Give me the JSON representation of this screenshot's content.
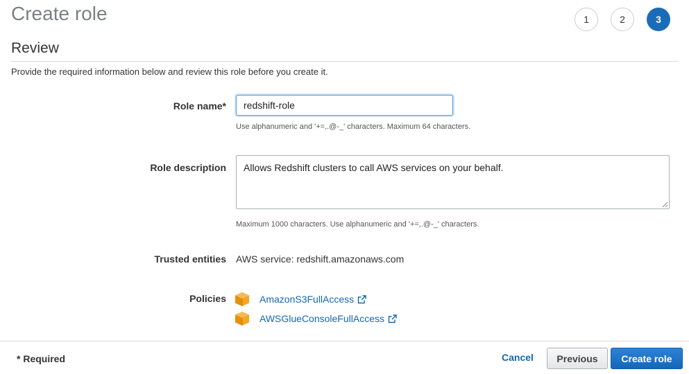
{
  "header": {
    "title": "Create role",
    "steps": [
      "1",
      "2",
      "3"
    ],
    "active_step": "3"
  },
  "review": {
    "section_title": "Review",
    "intro": "Provide the required information below and review this role before you create it."
  },
  "form": {
    "role_name": {
      "label": "Role name*",
      "value": "redshift-role",
      "hint": "Use alphanumeric and '+=,.@-_' characters. Maximum 64 characters."
    },
    "role_description": {
      "label": "Role description",
      "value": "Allows Redshift clusters to call AWS services on your behalf.",
      "hint": "Maximum 1000 characters. Use alphanumeric and '+=,.@-_' characters."
    },
    "trusted_entities": {
      "label": "Trusted entities",
      "value": "AWS service: redshift.amazonaws.com"
    },
    "policies": {
      "label": "Policies",
      "items": [
        {
          "name": "AmazonS3FullAccess",
          "icon": "policy-box-icon"
        },
        {
          "name": "AWSGlueConsoleFullAccess",
          "icon": "policy-box-icon"
        }
      ]
    }
  },
  "footer": {
    "required_note": "* Required",
    "cancel_label": "Cancel",
    "previous_label": "Previous",
    "create_label": "Create role"
  },
  "colors": {
    "accent": "#1a6cb8",
    "link": "#1567b0",
    "policy_icon": "#f0a30a"
  }
}
